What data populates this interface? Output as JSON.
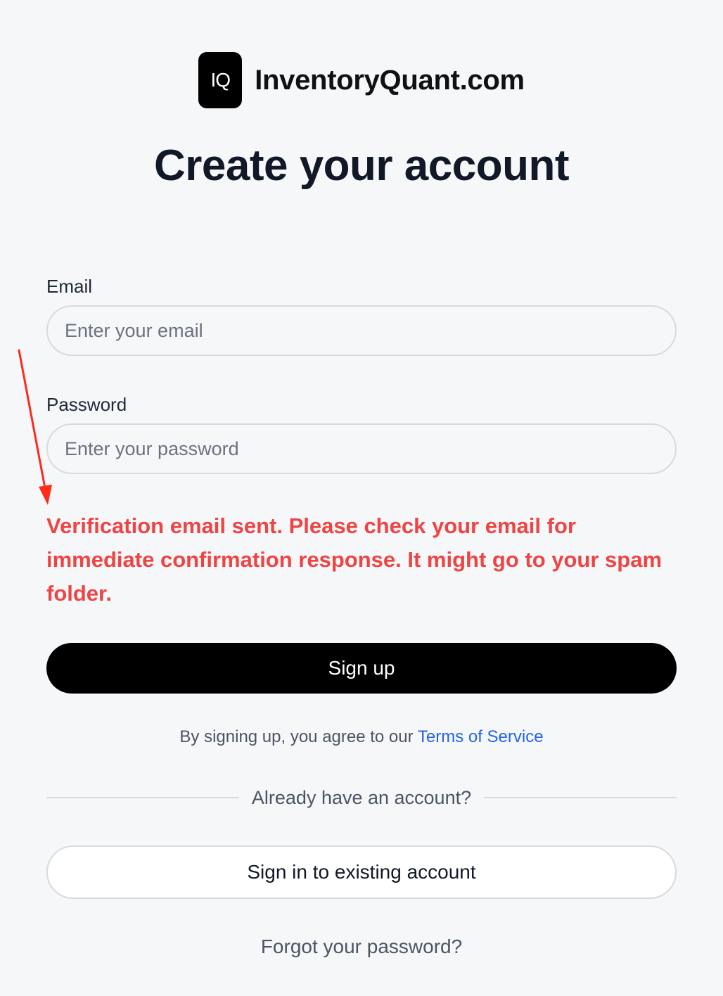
{
  "brand": {
    "logo_text": "IQ",
    "name": "InventoryQuant.com"
  },
  "page": {
    "title": "Create your account"
  },
  "form": {
    "email": {
      "label": "Email",
      "placeholder": "Enter your email",
      "value": ""
    },
    "password": {
      "label": "Password",
      "placeholder": "Enter your password",
      "value": ""
    },
    "message": "Verification email sent. Please check your email for immediate confirmation response. It might go to your spam folder.",
    "submit_label": "Sign up"
  },
  "terms": {
    "prefix": "By signing up, you agree to our ",
    "link_text": "Terms of Service"
  },
  "divider": {
    "text": "Already have an account?"
  },
  "signin": {
    "label": "Sign in to existing account"
  },
  "forgot": {
    "label": "Forgot your password?"
  },
  "colors": {
    "background": "#f6f7f9",
    "primary": "#000000",
    "error": "#ef4444",
    "link": "#2563eb",
    "annotation_arrow": "#ff2a1a"
  },
  "icons": {
    "annotation": "red-arrow-icon"
  }
}
